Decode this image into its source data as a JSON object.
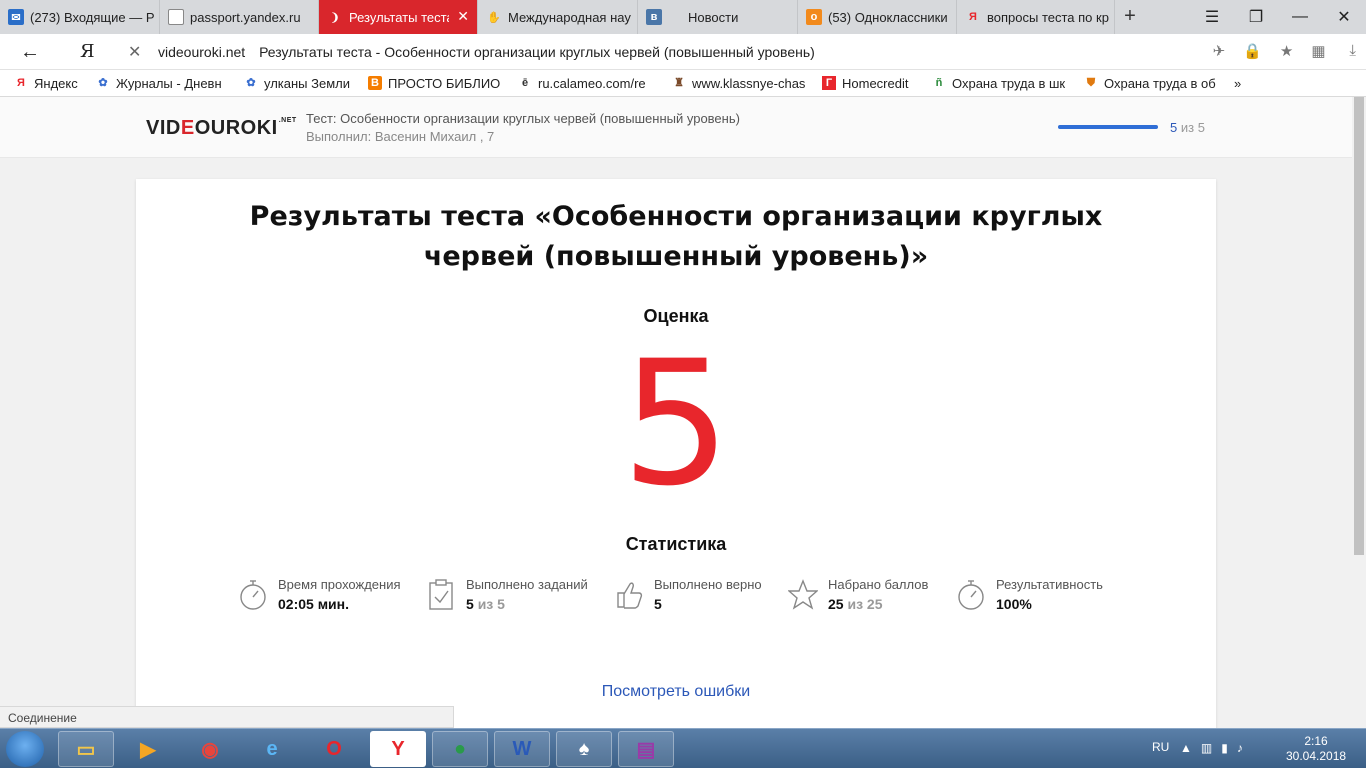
{
  "browser": {
    "tabs": [
      {
        "label": "(273) Входящие — Р",
        "icon": "mail-icon",
        "color": "#2a6ec8"
      },
      {
        "label": "passport.yandex.ru",
        "icon": "page-icon",
        "color": "#888888"
      },
      {
        "label": "Результаты теста",
        "icon": "yandex-icon",
        "color": "#ffffff",
        "active": true
      },
      {
        "label": "Международная нау",
        "icon": "hands-icon",
        "color": "#e8a030"
      },
      {
        "label": "Новости",
        "icon": "vk-icon",
        "color": "#4a76a8"
      },
      {
        "label": "(53) Одноклассники",
        "icon": "ok-icon",
        "color": "#f28a1c"
      },
      {
        "label": "вопросы теста по кр",
        "icon": "yandex-icon",
        "color": "#e8262c"
      }
    ],
    "new_tab": "+",
    "address": {
      "domain": "videouroki.net",
      "title": "Результаты теста - Особенности организации круглых червей (повышенный уровень)"
    },
    "bookmarks": [
      {
        "label": "Яндекс",
        "icon": "yandex-icon"
      },
      {
        "label": "Журналы - Дневн",
        "icon": "people-icon"
      },
      {
        "label": "улканы Земли",
        "icon": "people-icon"
      },
      {
        "label": "ПРОСТО БИБЛИО",
        "icon": "blogger-icon"
      },
      {
        "label": "ru.calameo.com/re",
        "icon": "calameo-icon"
      },
      {
        "label": "www.klassnye-chas",
        "icon": "figure-icon"
      },
      {
        "label": "Homecredit",
        "icon": "homecredit-icon"
      },
      {
        "label": "Охрана труда в шк",
        "icon": "leaf-icon"
      },
      {
        "label": "Охрана труда в об",
        "icon": "shield-icon"
      }
    ],
    "bookmarks_more": "»"
  },
  "site": {
    "logo": {
      "pre": "VID",
      "o": "E",
      "post": "OUROKI",
      "net": ".NET"
    },
    "test_line": "Тест: Особенности организации круглых червей (повышенный уровень)",
    "done_by": "Выполнил: Васенин Михаил , 7",
    "progress": {
      "current": "5",
      "of_text": "из 5",
      "fraction": 1.0
    }
  },
  "result": {
    "title": "Результаты теста «Особенности организации круглых червей (повышенный уровень)»",
    "grade_label": "Оценка",
    "grade": "5",
    "stats_title": "Статистика",
    "stats": [
      {
        "label": "Время прохождения",
        "value": "02:05 мин.",
        "icon": "stopwatch-icon"
      },
      {
        "label": "Выполнено заданий",
        "value": "5",
        "value_gray": "из 5",
        "icon": "clipboard-check-icon"
      },
      {
        "label": "Выполнено верно",
        "value": "5",
        "icon": "thumbs-up-icon"
      },
      {
        "label": "Набрано баллов",
        "value": "25",
        "value_gray": "из 25",
        "icon": "star-icon"
      },
      {
        "label": "Результативность",
        "value": "100%",
        "icon": "stopwatch-icon"
      }
    ],
    "view_mistakes": "Посмотреть ошибки"
  },
  "status_bar": "Соединение",
  "taskbar": {
    "lang": "RU",
    "time": "2:16",
    "date": "30.04.2018"
  },
  "colors": {
    "accent_red": "#e8262c",
    "link_blue": "#2c58b8",
    "progress_blue": "#2f6ed6"
  }
}
